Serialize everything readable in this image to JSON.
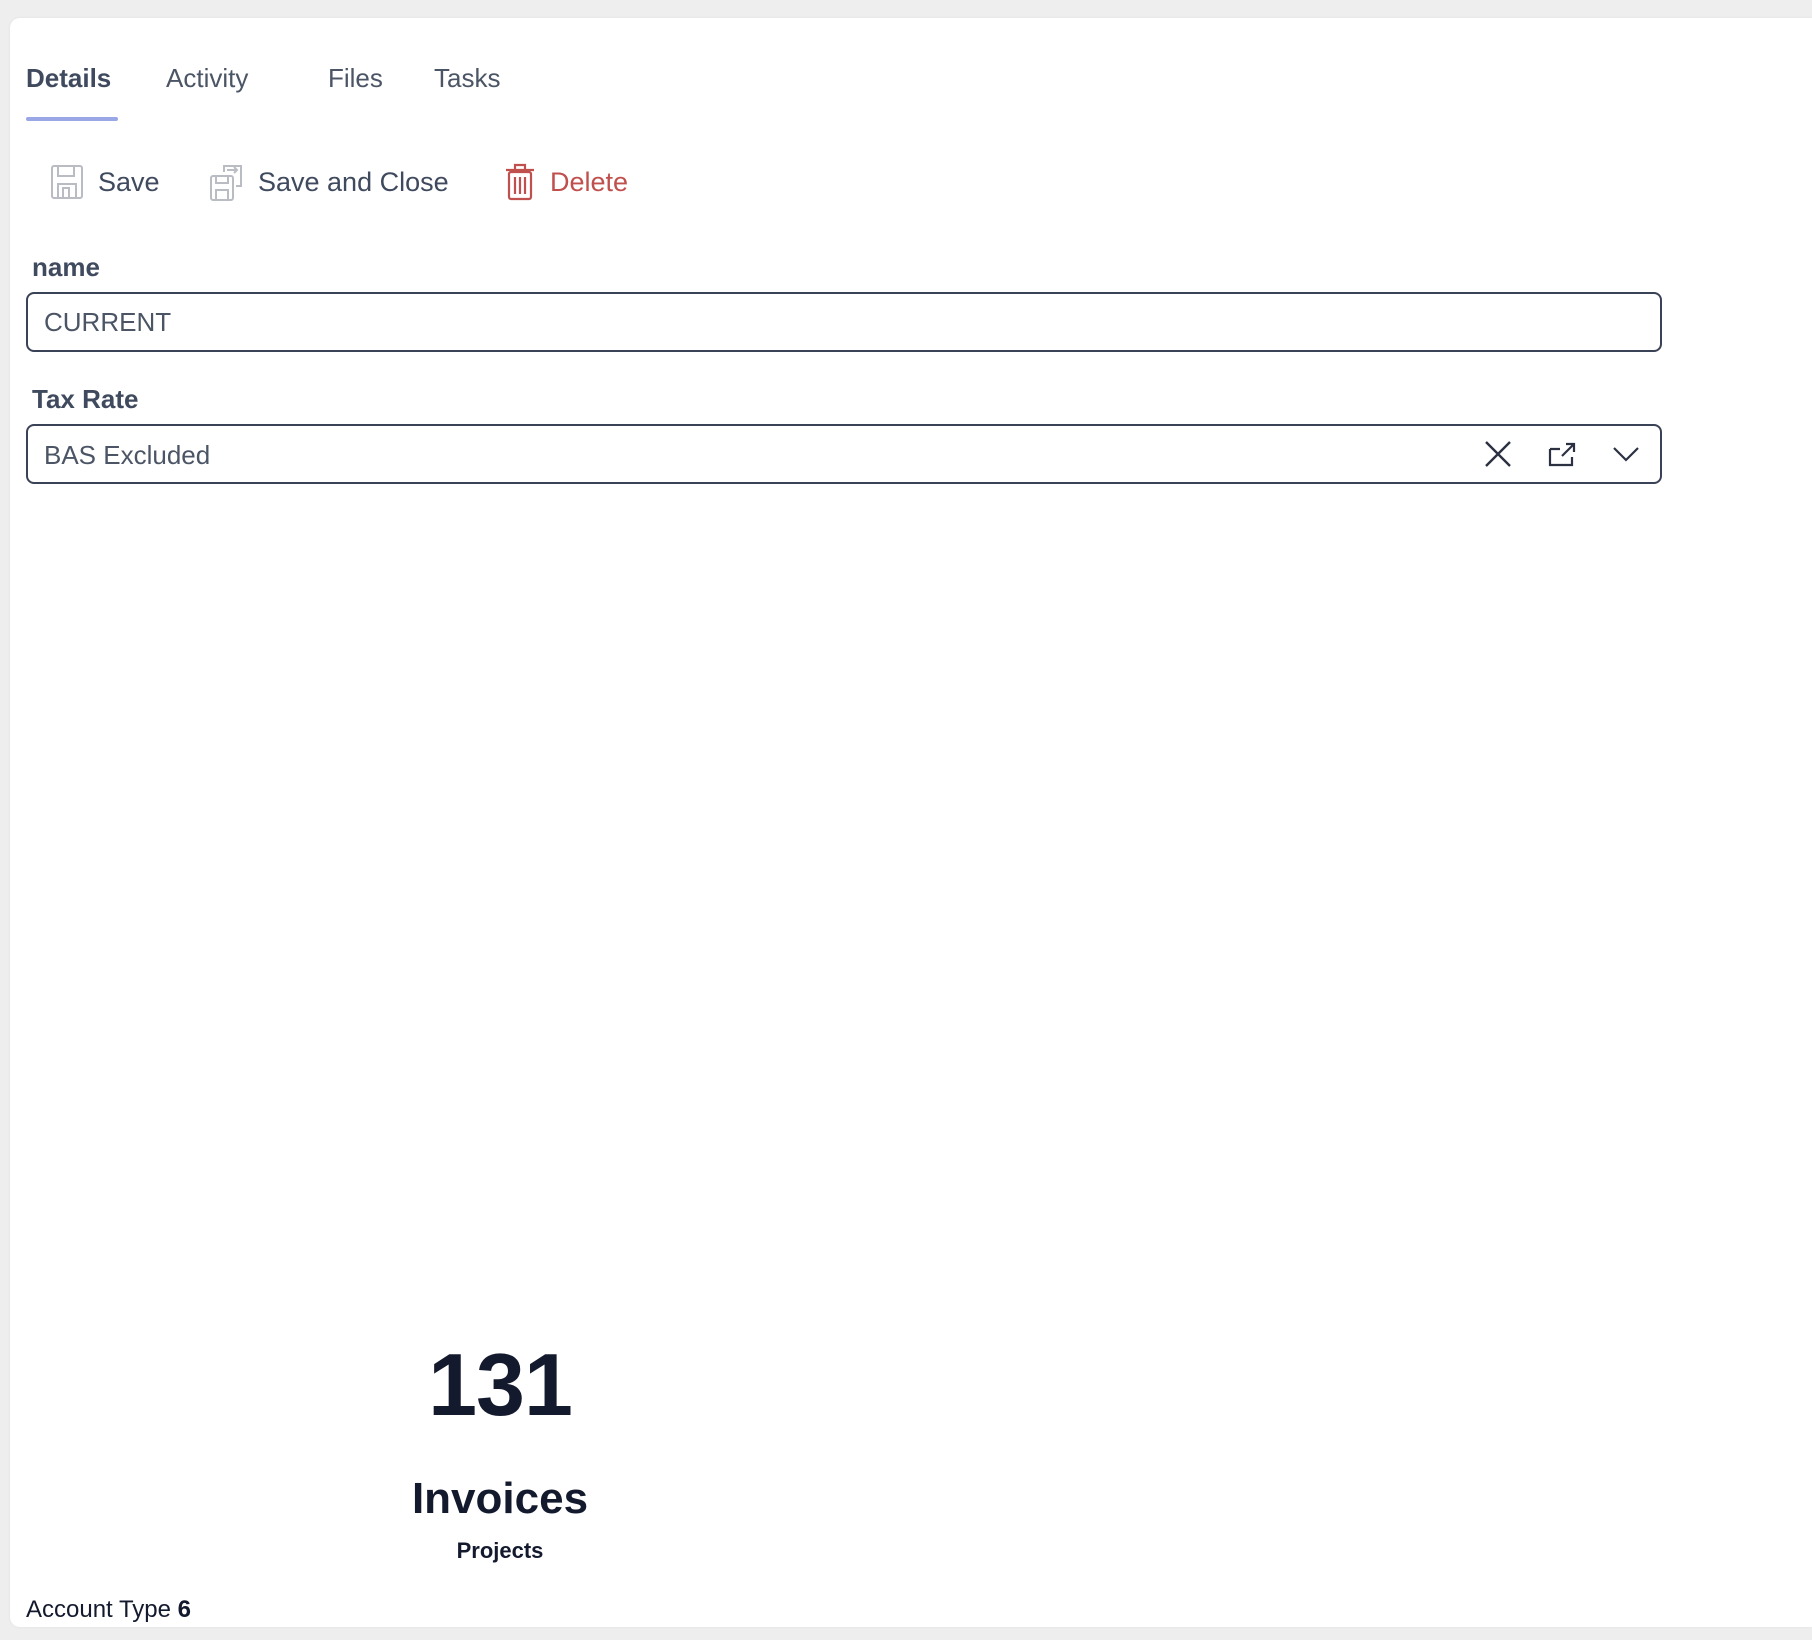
{
  "tabs": [
    {
      "label": "Details",
      "active": true
    },
    {
      "label": "Activity",
      "active": false
    },
    {
      "label": "Files",
      "active": false
    },
    {
      "label": "Tasks",
      "active": false
    }
  ],
  "toolbar": {
    "save_label": "Save",
    "save_close_label": "Save and Close",
    "delete_label": "Delete"
  },
  "form": {
    "name_label": "name",
    "name_value": "CURRENT",
    "tax_rate_label": "Tax Rate",
    "tax_rate_value": "BAS Excluded"
  },
  "stats": {
    "count": "131",
    "title": "Invoices",
    "subtitle": "Projects"
  },
  "footer": {
    "account_type_label": "Account Type",
    "account_type_value": "6"
  },
  "colors": {
    "accent": "#9aa7e6",
    "danger": "#c0504d",
    "text": "#3f4a5e",
    "dark": "#141a2e"
  },
  "icons": [
    "save-icon",
    "save-and-close-icon",
    "trash-icon",
    "clear-icon",
    "open-external-icon",
    "chevron-down-icon"
  ]
}
